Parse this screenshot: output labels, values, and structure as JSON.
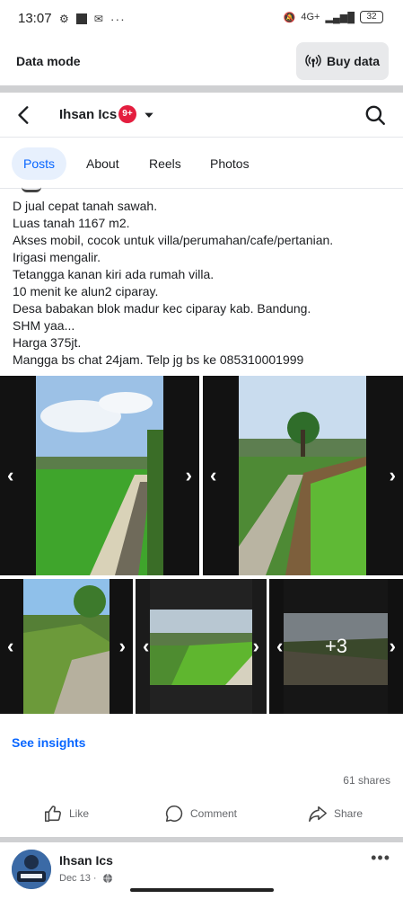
{
  "status_bar": {
    "time": "13:07",
    "battery": "32",
    "network": "4G+",
    "overflow": "···"
  },
  "data_mode": {
    "label": "Data mode",
    "button": "Buy data",
    "button_icon": "broadcast-icon"
  },
  "header": {
    "name": "Ihsan Ics",
    "badge": "9+",
    "back_icon": "back-arrow-icon",
    "search_icon": "search-icon",
    "caret_icon": "caret-down-icon"
  },
  "tabs": [
    {
      "label": "Posts",
      "active": true
    },
    {
      "label": "About",
      "active": false
    },
    {
      "label": "Reels",
      "active": false
    },
    {
      "label": "Photos",
      "active": false
    }
  ],
  "post": {
    "lines": [
      "D jual cepat tanah sawah.",
      "Luas tanah 1167 m2.",
      "Akses mobil, cocok untuk villa/perumahan/cafe/pertanian.",
      "Irigasi mengalir.",
      "Tetangga kanan kiri ada rumah villa.",
      "10 menit ke alun2 ciparay.",
      "Desa babakan blok madur kec ciparay kab. Bandung.",
      "SHM yaa...",
      "Harga 375jt.",
      "Mangga bs chat 24jam. Telp jg bs ke 085310001999"
    ],
    "more_photos": "+3",
    "see_insights": "See insights",
    "shares": "61 shares",
    "actions": {
      "like": "Like",
      "comment": "Comment",
      "share": "Share"
    }
  },
  "next_post": {
    "name": "Ihsan Ics",
    "date": "Dec 13 ·",
    "more": "•••"
  },
  "colors": {
    "accent": "#0866ff",
    "badge": "#e41e3f",
    "tab_active_bg": "#e7f0fd"
  }
}
